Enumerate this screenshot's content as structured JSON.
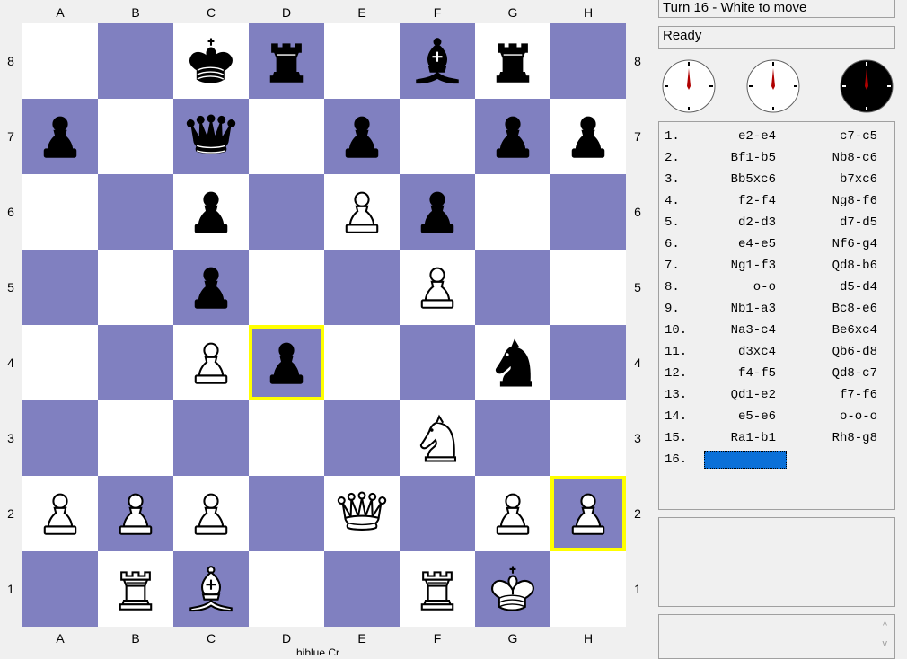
{
  "status": {
    "turn": "Turn 16 - White to move",
    "ready": "Ready"
  },
  "fragment_text": "hiblue Cr",
  "files": [
    "A",
    "B",
    "C",
    "D",
    "E",
    "F",
    "G",
    "H"
  ],
  "ranks": [
    "8",
    "7",
    "6",
    "5",
    "4",
    "3",
    "2",
    "1"
  ],
  "colors": {
    "light": "#ffffff",
    "dark": "#8080c0",
    "highlight": "#ffff00",
    "cursor": "#0a70d8"
  },
  "highlighted_squares": [
    "d4",
    "h2"
  ],
  "pieces": {
    "c8": "bK",
    "d8": "bR",
    "f8": "bB",
    "g8": "bR",
    "a7": "bP",
    "c7": "bQ",
    "e7": "bP",
    "g7": "bP",
    "h7": "bP",
    "c6": "bP",
    "e6": "wP",
    "f6": "bP",
    "c5": "bP",
    "f5": "wP",
    "c4": "wP",
    "d4": "bP",
    "g4": "bN",
    "f3": "wN",
    "a2": "wP",
    "b2": "wP",
    "c2": "wP",
    "e2": "wQ",
    "g2": "wP",
    "h2": "wP",
    "b1": "wR",
    "c1": "wB",
    "f1": "wR",
    "g1": "wK"
  },
  "clocks": [
    {
      "name": "white-clock",
      "face": "#ffffff",
      "hand": "#b00000"
    },
    {
      "name": "reference-clock",
      "face": "#ffffff",
      "hand": "#b00000"
    },
    {
      "name": "black-clock",
      "face": "#000000",
      "hand": "#b00000"
    }
  ],
  "moves": [
    {
      "num": "1.",
      "white": "e2-e4",
      "black": "c7-c5"
    },
    {
      "num": "2.",
      "white": "Bf1-b5",
      "black": "Nb8-c6"
    },
    {
      "num": "3.",
      "white": "Bb5xc6",
      "black": "b7xc6"
    },
    {
      "num": "4.",
      "white": "f2-f4",
      "black": "Ng8-f6"
    },
    {
      "num": "5.",
      "white": "d2-d3",
      "black": "d7-d5"
    },
    {
      "num": "6.",
      "white": "e4-e5",
      "black": "Nf6-g4"
    },
    {
      "num": "7.",
      "white": "Ng1-f3",
      "black": "Qd8-b6"
    },
    {
      "num": "8.",
      "white": "o-o",
      "black": "d5-d4"
    },
    {
      "num": "9.",
      "white": "Nb1-a3",
      "black": "Bc8-e6"
    },
    {
      "num": "10.",
      "white": "Na3-c4",
      "black": "Be6xc4"
    },
    {
      "num": "11.",
      "white": "d3xc4",
      "black": "Qb6-d8"
    },
    {
      "num": "12.",
      "white": "f4-f5",
      "black": "Qd8-c7"
    },
    {
      "num": "13.",
      "white": "Qd1-e2",
      "black": "f7-f6"
    },
    {
      "num": "14.",
      "white": "e5-e6",
      "black": "o-o-o"
    },
    {
      "num": "15.",
      "white": "Ra1-b1",
      "black": "Rh8-g8"
    },
    {
      "num": "16.",
      "white": "",
      "black": ""
    }
  ],
  "scroll": {
    "up": "^",
    "down": "v"
  }
}
